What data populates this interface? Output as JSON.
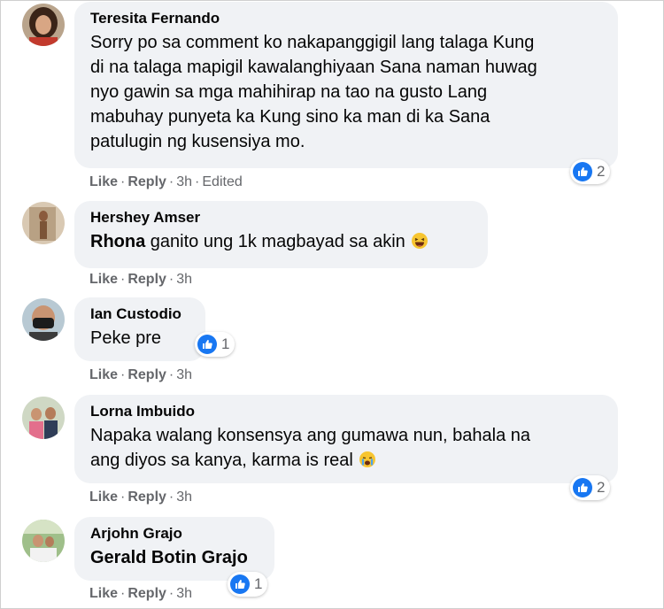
{
  "colors": {
    "bubble": "#f0f2f5",
    "meta": "#65676b",
    "like_blue": "#1877f2"
  },
  "comments": [
    {
      "author": "Teresita Fernando",
      "lines": [
        "Sorry po sa comment ko nakapanggigil lang talaga Kung",
        "di na talaga mapigil kawalanghiyaan Sana naman huwag",
        "nyo gawin sa mga mahihirap na tao na gusto Lang",
        "mabuhay punyeta ka Kung sino ka man di ka Sana",
        "patulugin ng kusensiya mo."
      ],
      "like": "Like",
      "reply": "Reply",
      "time": "3h",
      "edited": "Edited",
      "reaction_icon": "like-icon",
      "reaction_count": "2"
    },
    {
      "author": "Hershey Amser",
      "tag": "Rhona",
      "text": "ganito ung 1k magbayad sa akin",
      "emoji": "laughing-emoji",
      "like": "Like",
      "reply": "Reply",
      "time": "3h"
    },
    {
      "author": "Ian Custodio",
      "text": "Peke pre",
      "like": "Like",
      "reply": "Reply",
      "time": "3h",
      "reaction_icon": "like-icon",
      "reaction_count": "1"
    },
    {
      "author": "Lorna Imbuido",
      "lines": [
        "Napaka walang konsensya ang gumawa nun, bahala na",
        "ang diyos sa kanya, karma is real"
      ],
      "emoji": "crying-emoji",
      "like": "Like",
      "reply": "Reply",
      "time": "3h",
      "reaction_icon": "like-icon",
      "reaction_count": "2"
    },
    {
      "author": "Arjohn Grajo",
      "tag": "Gerald Botin Grajo",
      "like": "Like",
      "reply": "Reply",
      "time": "3h",
      "reaction_icon": "like-icon",
      "reaction_count": "1"
    }
  ]
}
